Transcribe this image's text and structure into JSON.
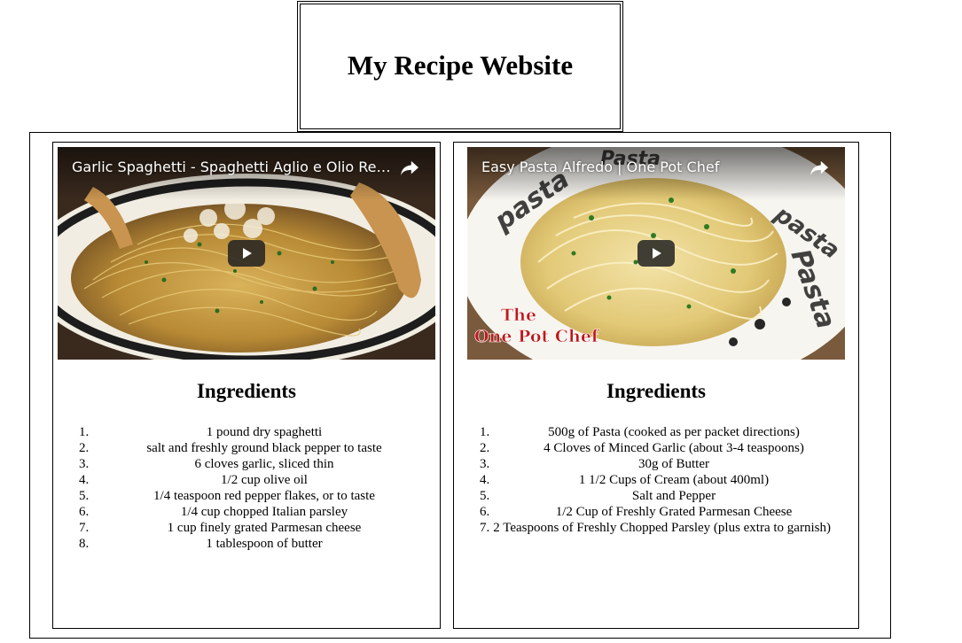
{
  "site": {
    "title": "My Recipe Website"
  },
  "recipes": [
    {
      "video_title": "Garlic Spaghetti - Spaghetti Aglio e Olio Rec...",
      "ingredients_heading": "Ingredients",
      "ingredients": [
        "1 pound dry spaghetti",
        "salt and freshly ground black pepper to taste",
        "6 cloves garlic, sliced thin",
        "1/2 cup olive oil",
        "1/4 teaspoon red pepper flakes, or to taste",
        "1/4 cup chopped Italian parsley",
        "1 cup finely grated Parmesan cheese",
        "1 tablespoon of butter"
      ]
    },
    {
      "video_title": "Easy Pasta Alfredo | One Pot Chef",
      "thumbnail_text": {
        "line1": "The",
        "line2": "One Pot Chef"
      },
      "ingredients_heading": "Ingredients",
      "ingredients": [
        "500g of Pasta (cooked as per packet directions)",
        "4 Cloves of Minced Garlic (about 3-4 teaspoons)",
        "30g of Butter",
        "1 1/2 Cups of Cream (about 400ml)",
        "Salt and Pepper",
        "1/2 Cup of Freshly Grated Parmesan Cheese",
        "2 Teaspoons of Freshly Chopped Parsley (plus extra to garnish)"
      ]
    }
  ],
  "list_numbers": [
    "1.",
    "2.",
    "3.",
    "4.",
    "5.",
    "6.",
    "7.",
    "8."
  ],
  "colors": {
    "border": "#000000",
    "overlay_text": "#ffffff",
    "play_button": "#212121"
  },
  "icons": {
    "share": "share-icon",
    "play": "play-icon"
  }
}
